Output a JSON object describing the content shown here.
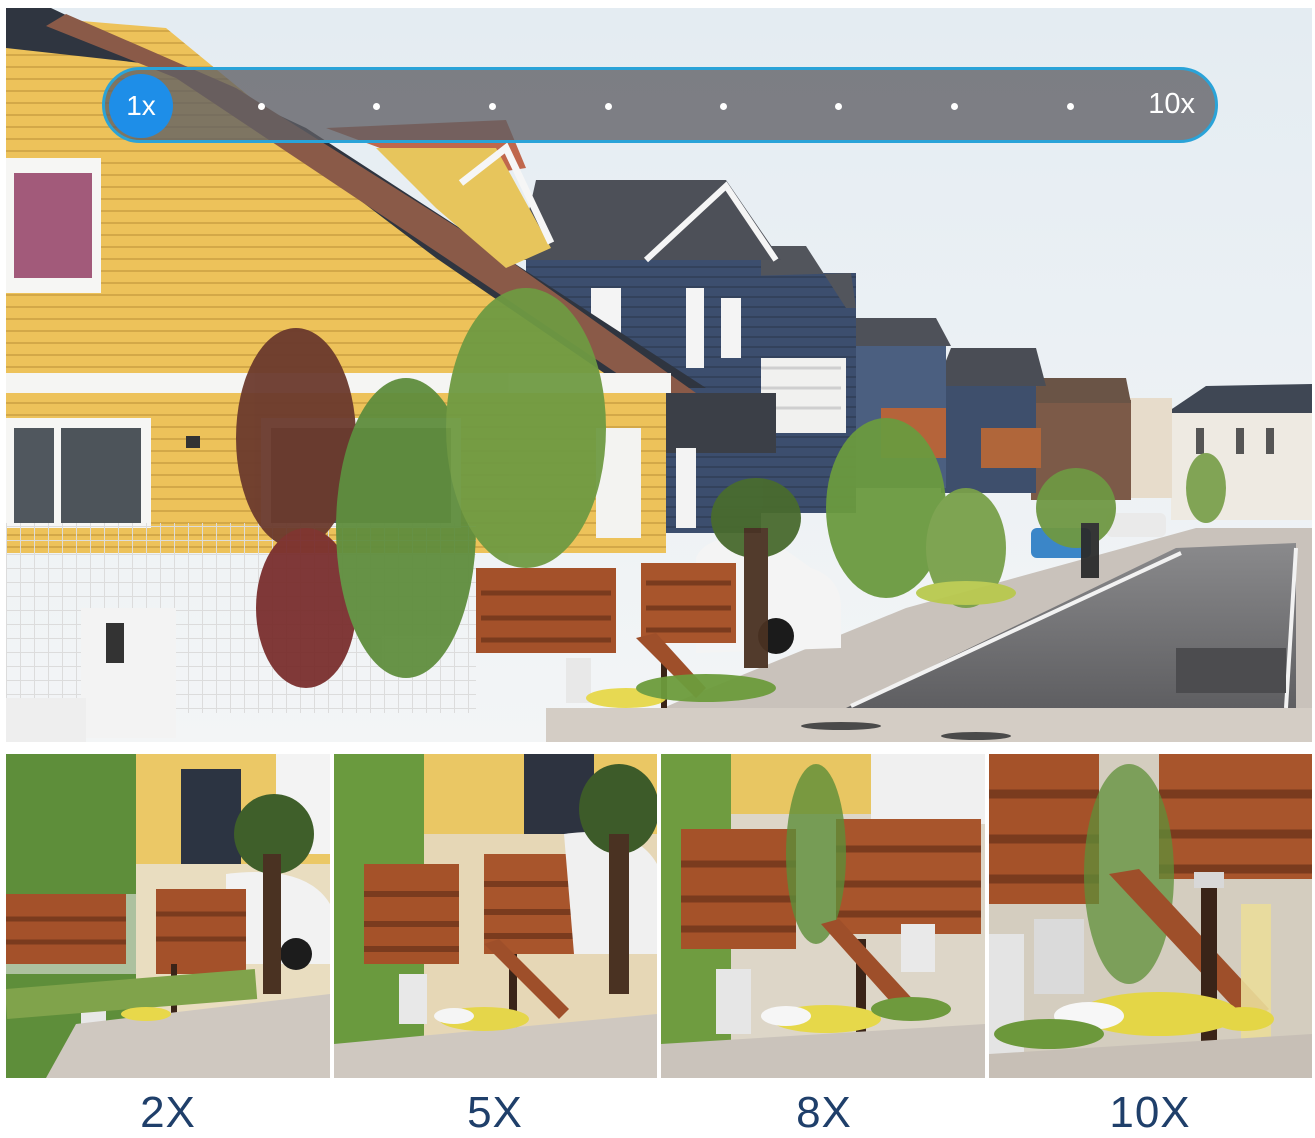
{
  "zoom_slider": {
    "min_label": "1x",
    "max_label": "10x",
    "current_level": 1,
    "steps": 10,
    "colors": {
      "knob": "#1e8ee8",
      "border": "#2aa3d8",
      "track": "#5f5f64"
    }
  },
  "main_photo": {
    "subject": "suburban-street-houses"
  },
  "thumbnails": [
    {
      "label": "2X"
    },
    {
      "label": "5X"
    },
    {
      "label": "8X"
    },
    {
      "label": "10X"
    }
  ],
  "label_color": "#1f3f6a"
}
